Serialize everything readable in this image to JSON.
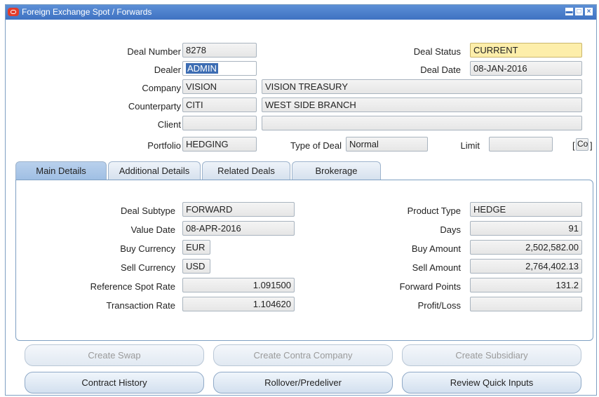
{
  "window": {
    "title": "Foreign Exchange Spot / Forwards",
    "min_label": "▬",
    "max_label": "□",
    "close_label": "×"
  },
  "header": {
    "deal_number": {
      "label": "Deal Number",
      "value": "8278"
    },
    "dealer": {
      "label": "Dealer",
      "value": "ADMIN"
    },
    "company": {
      "label": "Company",
      "code": "VISION",
      "name": "VISION TREASURY"
    },
    "counterparty": {
      "label": "Counterparty",
      "code": "CITI",
      "name": "WEST SIDE BRANCH"
    },
    "client": {
      "label": "Client",
      "code": "",
      "name": ""
    },
    "portfolio": {
      "label": "Portfolio",
      "value": "HEDGING"
    },
    "deal_status": {
      "label": "Deal Status",
      "value": "CURRENT"
    },
    "deal_date": {
      "label": "Deal Date",
      "value": "08-JAN-2016"
    },
    "type_of_deal": {
      "label": "Type of Deal",
      "value": "Normal"
    },
    "limit": {
      "label": "Limit",
      "value": "",
      "bracket_open": "[",
      "context": "Co",
      "bracket_close": "]"
    }
  },
  "tabs": [
    {
      "label": "Main Details",
      "active": true
    },
    {
      "label": "Additional Details",
      "active": false
    },
    {
      "label": "Related Deals",
      "active": false
    },
    {
      "label": "Brokerage",
      "active": false
    }
  ],
  "main": {
    "deal_subtype": {
      "label": "Deal Subtype",
      "value": "FORWARD"
    },
    "value_date": {
      "label": "Value Date",
      "value": "08-APR-2016"
    },
    "buy_currency": {
      "label": "Buy Currency",
      "value": "EUR"
    },
    "sell_currency": {
      "label": "Sell Currency",
      "value": "USD"
    },
    "reference_spot_rate": {
      "label": "Reference Spot Rate",
      "value": "1.091500"
    },
    "transaction_rate": {
      "label": "Transaction Rate",
      "value": "1.104620"
    },
    "product_type": {
      "label": "Product Type",
      "value": "HEDGE"
    },
    "days": {
      "label": "Days",
      "value": "91"
    },
    "buy_amount": {
      "label": "Buy Amount",
      "value": "2,502,582.00"
    },
    "sell_amount": {
      "label": "Sell Amount",
      "value": "2,764,402.13"
    },
    "forward_points": {
      "label": "Forward Points",
      "value": "131.2"
    },
    "profit_loss": {
      "label": "Profit/Loss",
      "value": ""
    }
  },
  "buttons": {
    "create_swap": "Create Swap",
    "create_contra_company": "Create Contra Company",
    "create_subsidiary": "Create Subsidiary",
    "contract_history": "Contract History",
    "rollover_predeliver": "Rollover/Predeliver",
    "review_quick_inputs": "Review Quick Inputs"
  }
}
